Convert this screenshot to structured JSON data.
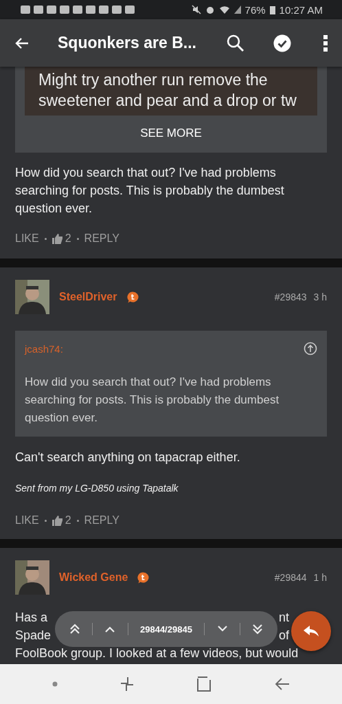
{
  "status_bar": {
    "battery": "76%",
    "time": "10:27 AM"
  },
  "app_bar": {
    "title": "Squonkers are B..."
  },
  "posts": [
    {
      "kind": "continued",
      "image_lines": [
        "Might try another run remove the",
        "sweetener and pear and a drop or tw"
      ],
      "see_more": "SEE MORE",
      "body": "How did you search that out? I've had problems searching for posts. This is probably the dumbest question ever.",
      "actions": {
        "like": "LIKE",
        "like_count": "2",
        "reply": "REPLY"
      }
    },
    {
      "kind": "full",
      "author": "SteelDriver",
      "post_number": "#29843",
      "time": "3 h",
      "quote": {
        "author": "jcash74:",
        "text": "How did you search that out? I've had problems searching for posts. This is probably the dumbest question ever."
      },
      "body": "Can't search anything on tapacrap either.",
      "signature": "Sent from my LG-D850 using Tapatalk",
      "actions": {
        "like": "LIKE",
        "like_count": "2",
        "reply": "REPLY"
      }
    },
    {
      "kind": "covered",
      "author": "Wicked Gene",
      "post_number": "#29844",
      "time": "1 h",
      "body_lines": [
        {
          "left": "Has a",
          "right": "nt"
        },
        {
          "left": "Spade",
          "right": "of"
        },
        {
          "left": "FoolBook group. I looked at a few videos, but would"
        }
      ]
    }
  ],
  "thread_nav": {
    "position": "29844/29845"
  }
}
